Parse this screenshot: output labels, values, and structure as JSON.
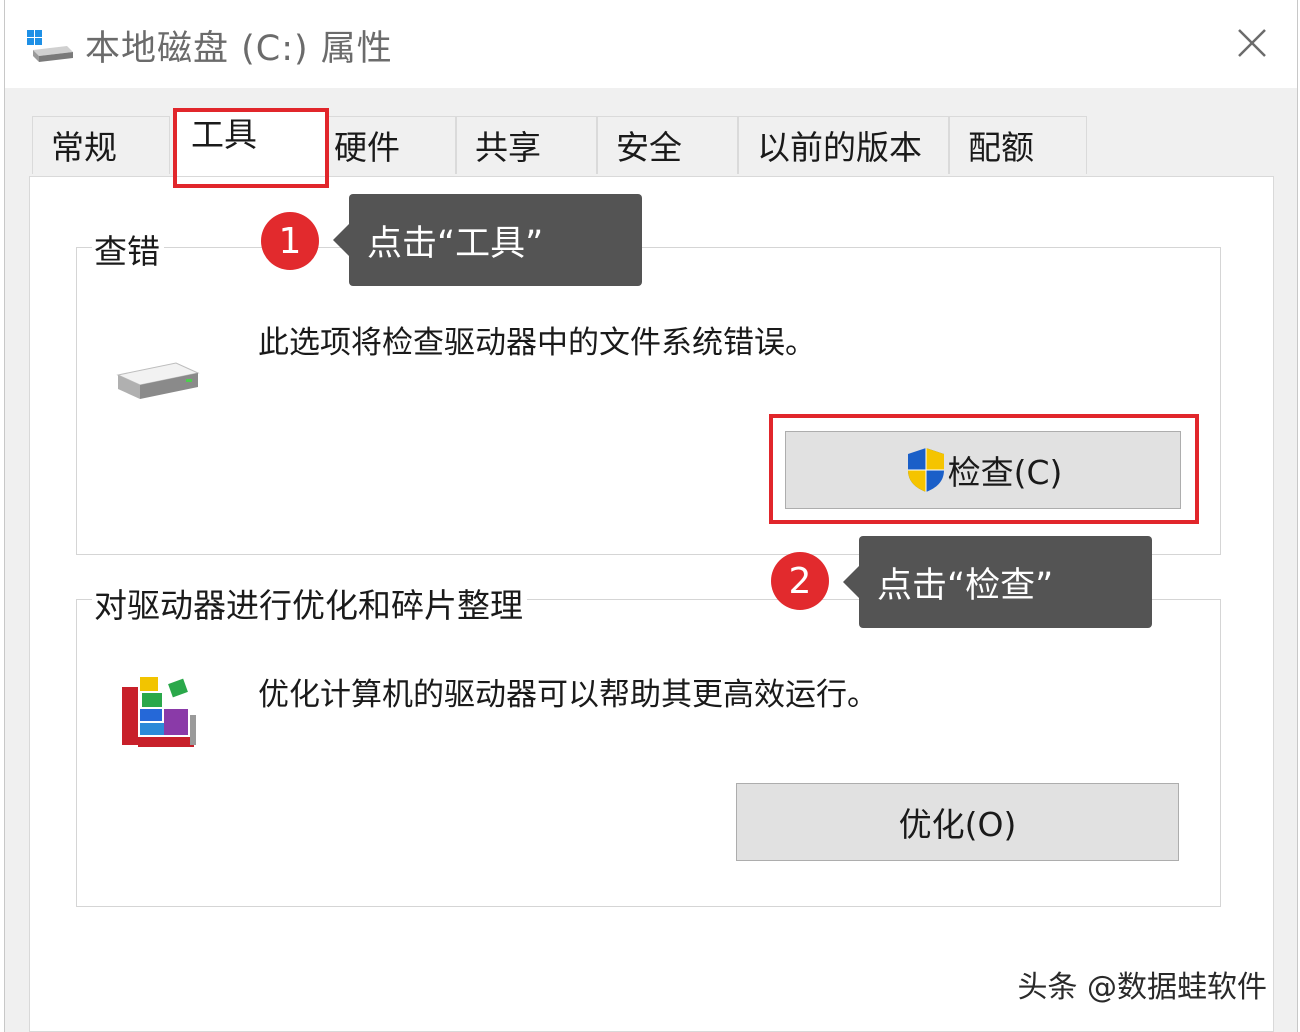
{
  "window": {
    "title": "本地磁盘 (C:) 属性",
    "drive_icon": "drive-icon",
    "close_icon": "close-icon"
  },
  "tabs": [
    {
      "label": "常规"
    },
    {
      "label": "工具",
      "active": true
    },
    {
      "label": "硬件"
    },
    {
      "label": "共享"
    },
    {
      "label": "安全"
    },
    {
      "label": "以前的版本"
    },
    {
      "label": "配额"
    }
  ],
  "error_check": {
    "group_title": "查错",
    "description": "此选项将检查驱动器中的文件系统错误。",
    "button_label": "检查(C)",
    "icon": "hard-drive-icon",
    "button_icon": "uac-shield-icon"
  },
  "optimize": {
    "group_title": "对驱动器进行优化和碎片整理",
    "description": "优化计算机的驱动器可以帮助其更高效运行。",
    "button_label": "优化(O)",
    "icon": "defrag-icon"
  },
  "annotations": [
    {
      "number": "1",
      "text": "点击“工具”"
    },
    {
      "number": "2",
      "text": "点击“检查”"
    }
  ],
  "watermark": "头条 @数据蛙软件",
  "colors": {
    "highlight": "#e1262b",
    "badge": "#e22a2d",
    "callout_bg": "#545454"
  }
}
